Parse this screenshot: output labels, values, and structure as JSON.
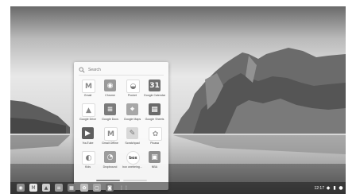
{
  "launcher": {
    "search_placeholder": "Search",
    "apps": [
      {
        "label": "Gmail",
        "glyph": "M",
        "bg": "#ffffff",
        "fg": "#8a8a8a",
        "icon": "gmail-icon"
      },
      {
        "label": "Chrome",
        "glyph": "◉",
        "bg": "#9a9a9a",
        "fg": "#ffffff",
        "icon": "chrome-icon"
      },
      {
        "label": "Pocket",
        "glyph": "◒",
        "bg": "#ffffff",
        "fg": "#7a7a7a",
        "icon": "pocket-icon"
      },
      {
        "label": "Google Calendar",
        "glyph": "31",
        "bg": "#6f6f6f",
        "fg": "#ffffff",
        "icon": "calendar-icon"
      },
      {
        "label": "Google Drive",
        "glyph": "▲",
        "bg": "#ffffff",
        "fg": "#888888",
        "icon": "drive-icon"
      },
      {
        "label": "Google Docs",
        "glyph": "≡",
        "bg": "#7b7b7b",
        "fg": "#ffffff",
        "icon": "docs-icon"
      },
      {
        "label": "Google Maps",
        "glyph": "⌖",
        "bg": "#a7a7a7",
        "fg": "#ffffff",
        "icon": "maps-icon"
      },
      {
        "label": "Google Sheets",
        "glyph": "▦",
        "bg": "#6a6a6a",
        "fg": "#ffffff",
        "icon": "sheets-icon"
      },
      {
        "label": "YouTube",
        "glyph": "▶",
        "bg": "#5e5e5e",
        "fg": "#ffffff",
        "icon": "youtube-icon"
      },
      {
        "label": "Gmail Offline",
        "glyph": "M",
        "bg": "#ffffff",
        "fg": "#8a8a8a",
        "icon": "gmail-offline-icon"
      },
      {
        "label": "Scratchpad",
        "glyph": "✎",
        "bg": "#d8d8d8",
        "fg": "#777777",
        "icon": "scratchpad-icon"
      },
      {
        "label": "Picasa",
        "glyph": "✿",
        "bg": "#ffffff",
        "fg": "#9a9a9a",
        "icon": "picasa-icon"
      },
      {
        "label": "Kids",
        "glyph": "◐",
        "bg": "#ffffff",
        "fg": "#777777",
        "icon": "kids-icon"
      },
      {
        "label": "Dropbound",
        "glyph": "◔",
        "bg": "#9c9c9c",
        "fg": "#ffffff",
        "icon": "dropbound-icon"
      },
      {
        "label": "box onebeing...",
        "glyph": "box",
        "bg": "#ffffff",
        "fg": "#333333",
        "icon": "box-icon"
      },
      {
        "label": "NBA",
        "glyph": "▣",
        "bg": "#8e8e8e",
        "fg": "#ffffff",
        "icon": "nba-icon"
      }
    ]
  },
  "shelf": {
    "apps": [
      {
        "icon": "chrome-shelf-icon",
        "glyph": "◉",
        "bg": "#8d8d8d"
      },
      {
        "icon": "gmail-shelf-icon",
        "glyph": "M",
        "bg": "#e6e6e6"
      },
      {
        "icon": "drive-shelf-icon",
        "glyph": "▲",
        "bg": "#cfcfcf"
      },
      {
        "icon": "docs-shelf-icon",
        "glyph": "≡",
        "bg": "#9a9a9a"
      },
      {
        "icon": "sheets-shelf-icon",
        "glyph": "▦",
        "bg": "#7a7a7a"
      },
      {
        "icon": "picasa-shelf-icon",
        "glyph": "✿",
        "bg": "#bdbdbd"
      },
      {
        "icon": "files-shelf-icon",
        "glyph": "▢",
        "bg": "#a5a5a5"
      },
      {
        "icon": "camera-shelf-icon",
        "glyph": "◙",
        "bg": "#6e6e6e"
      },
      {
        "icon": "app-launcher-icon",
        "glyph": "⋮⋮",
        "bg": "transparent"
      }
    ],
    "clock": "12:17"
  }
}
